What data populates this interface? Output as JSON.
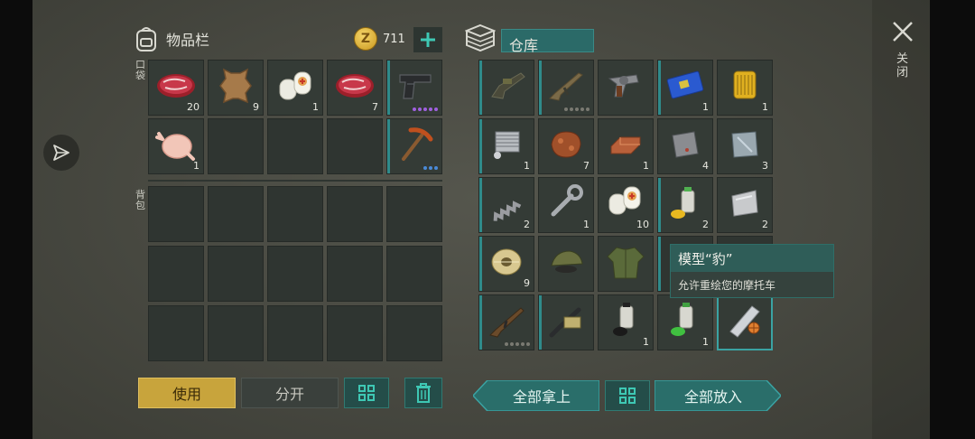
{
  "inventory": {
    "title": "物品栏",
    "coins": "711",
    "pocket_label": "口袋",
    "backpack_label": "背包",
    "pocket_slots": [
      {
        "icon": "raw-meat-icon",
        "qty": "20"
      },
      {
        "icon": "leather-hide-icon",
        "qty": "9"
      },
      {
        "icon": "bandage-icon",
        "qty": "1"
      },
      {
        "icon": "raw-meat-icon",
        "qty": "7"
      },
      {
        "icon": "pistol-icon",
        "qty": ""
      },
      {
        "icon": "raw-chicken-icon",
        "qty": "1"
      },
      {
        "icon": "",
        "qty": ""
      },
      {
        "icon": "",
        "qty": ""
      },
      {
        "icon": "",
        "qty": ""
      },
      {
        "icon": "pickaxe-icon",
        "qty": ""
      }
    ],
    "use_label": "使用",
    "split_label": "分开"
  },
  "storage": {
    "title": "仓库",
    "slots": [
      {
        "icon": "grenade-launcher-icon",
        "qty": ""
      },
      {
        "icon": "assault-rifle-icon",
        "qty": ""
      },
      {
        "icon": "revolver-icon",
        "qty": ""
      },
      {
        "icon": "circuit-board-icon",
        "qty": "1"
      },
      {
        "icon": "oil-filter-icon",
        "qty": "1"
      },
      {
        "icon": "engine-cylinder-icon",
        "qty": "1"
      },
      {
        "icon": "copper-ore-icon",
        "qty": "7"
      },
      {
        "icon": "copper-ingot-icon",
        "qty": "1"
      },
      {
        "icon": "iron-plate-icon",
        "qty": "4"
      },
      {
        "icon": "steel-plate-icon",
        "qty": "3"
      },
      {
        "icon": "spring-icon",
        "qty": "2"
      },
      {
        "icon": "wrench-icon",
        "qty": "1"
      },
      {
        "icon": "bandage-icon",
        "qty": "10"
      },
      {
        "icon": "spray-paint-yellow-icon",
        "qty": "2"
      },
      {
        "icon": "aluminum-plate-icon",
        "qty": "2"
      },
      {
        "icon": "wire-spool-icon",
        "qty": "9"
      },
      {
        "icon": "camo-cap-icon",
        "qty": ""
      },
      {
        "icon": "camo-jacket-icon",
        "qty": ""
      },
      {
        "icon": "",
        "qty": ""
      },
      {
        "icon": "",
        "qty": ""
      },
      {
        "icon": "ak-rifle-icon",
        "qty": ""
      },
      {
        "icon": "flamethrower-icon",
        "qty": ""
      },
      {
        "icon": "spray-paint-black-icon",
        "qty": "1"
      },
      {
        "icon": "spray-paint-green-icon",
        "qty": "1"
      },
      {
        "icon": "blueprint-scroll-icon",
        "qty": ""
      }
    ],
    "take_all_label": "全部拿上",
    "put_all_label": "全部放入"
  },
  "tooltip": {
    "title": "模型“豹”",
    "description": "允许重绘您的摩托车"
  },
  "close_label": "关闭",
  "colors": {
    "accent": "#2f8b8b",
    "use_button": "#c8a43c",
    "panel": "#2f3531"
  }
}
